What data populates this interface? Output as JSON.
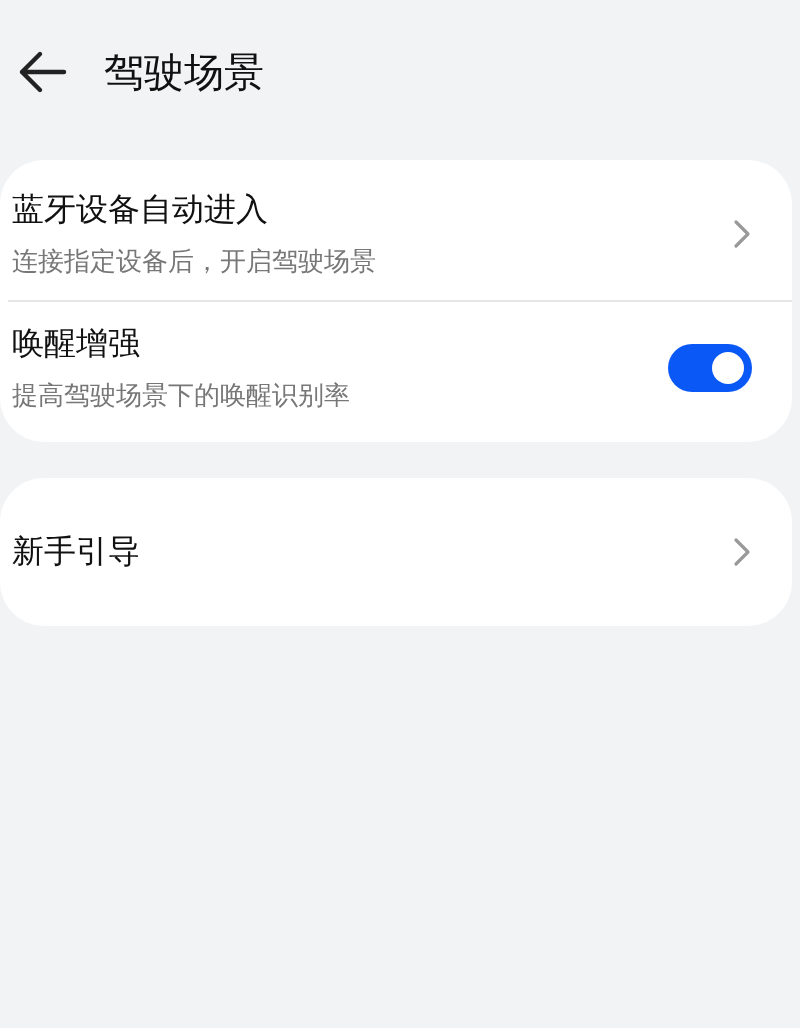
{
  "header": {
    "title": "驾驶场景"
  },
  "groups": [
    {
      "items": [
        {
          "kind": "link",
          "title": "蓝牙设备自动进入",
          "subtitle": "连接指定设备后，开启驾驶场景"
        },
        {
          "kind": "switch",
          "title": "唤醒增强",
          "subtitle": "提高驾驶场景下的唤醒识别率",
          "on": true
        }
      ]
    },
    {
      "items": [
        {
          "kind": "link",
          "title": "新手引导"
        }
      ]
    }
  ]
}
